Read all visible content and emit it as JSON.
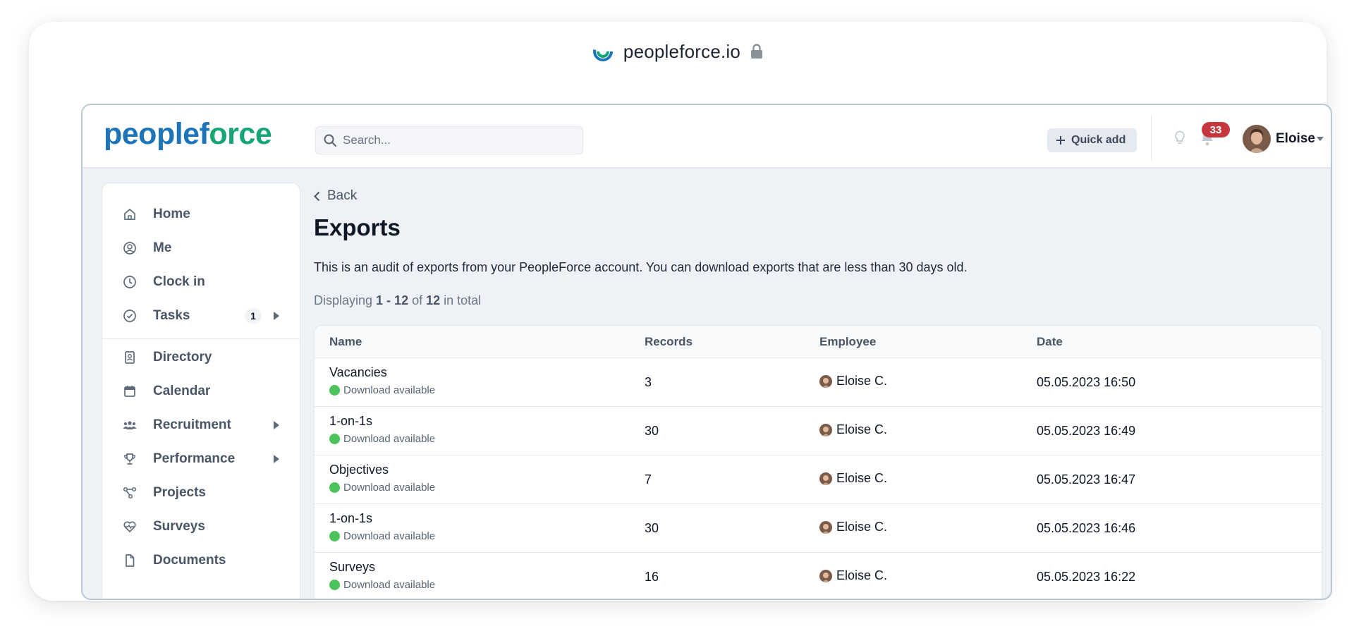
{
  "browser": {
    "domain": "peopleforce.io"
  },
  "brand": {
    "part1": "peoplef",
    "part2": "orce"
  },
  "search": {
    "placeholder": "Search..."
  },
  "header": {
    "quick_add_label": "Quick add",
    "notifications_count": "33",
    "user_name": "Eloise"
  },
  "sidebar": {
    "items": [
      {
        "label": "Home"
      },
      {
        "label": "Me"
      },
      {
        "label": "Clock in"
      },
      {
        "label": "Tasks",
        "count": "1"
      },
      {
        "label": "Directory"
      },
      {
        "label": "Calendar"
      },
      {
        "label": "Recruitment"
      },
      {
        "label": "Performance"
      },
      {
        "label": "Projects"
      },
      {
        "label": "Surveys"
      },
      {
        "label": "Documents"
      }
    ]
  },
  "page": {
    "back_label": "Back",
    "title": "Exports",
    "description": "This is an audit of exports from your PeopleForce account. You can download exports that are less than 30 days old.",
    "displaying": {
      "prefix": "Displaying ",
      "range": "1 - 12",
      "of": " of ",
      "total": "12",
      "suffix": " in total"
    }
  },
  "table": {
    "columns": [
      "Name",
      "Records",
      "Employee",
      "Date"
    ],
    "rows": [
      {
        "name": "Vacancies",
        "status": "Download available",
        "records": "3",
        "employee": "Eloise C.",
        "date": "05.05.2023 16:50"
      },
      {
        "name": "1-on-1s",
        "status": "Download available",
        "records": "30",
        "employee": "Eloise C.",
        "date": "05.05.2023 16:49"
      },
      {
        "name": "Objectives",
        "status": "Download available",
        "records": "7",
        "employee": "Eloise C.",
        "date": "05.05.2023 16:47"
      },
      {
        "name": "1-on-1s",
        "status": "Download available",
        "records": "30",
        "employee": "Eloise C.",
        "date": "05.05.2023 16:46"
      },
      {
        "name": "Surveys",
        "status": "Download available",
        "records": "16",
        "employee": "Eloise C.",
        "date": "05.05.2023 16:22"
      }
    ]
  },
  "colors": {
    "brand_blue": "#1e74b8",
    "brand_green": "#17a673",
    "badge_red": "#c6363f",
    "status_green": "#4cc35a"
  }
}
